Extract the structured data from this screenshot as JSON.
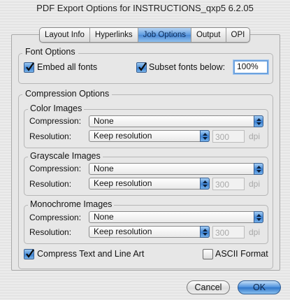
{
  "window": {
    "title": "PDF Export Options for INSTRUCTIONS_qxp5 6.2.05"
  },
  "tabs": [
    {
      "label": "Layout Info"
    },
    {
      "label": "Hyperlinks"
    },
    {
      "label": "Job Options",
      "active": true
    },
    {
      "label": "Output"
    },
    {
      "label": "OPI"
    }
  ],
  "font_options": {
    "title": "Font Options",
    "embed_all_fonts": {
      "label": "Embed all fonts",
      "checked": true
    },
    "subset_fonts": {
      "label": "Subset fonts below:",
      "checked": true,
      "value": "100%"
    }
  },
  "compression": {
    "title": "Compression Options",
    "groups": [
      {
        "title": "Color Images",
        "compression_label": "Compression:",
        "compression_value": "None",
        "resolution_label": "Resolution:",
        "resolution_value": "Keep resolution",
        "dpi_value": "300",
        "dpi_unit": "dpi"
      },
      {
        "title": "Grayscale Images",
        "compression_label": "Compression:",
        "compression_value": "None",
        "resolution_label": "Resolution:",
        "resolution_value": "Keep resolution",
        "dpi_value": "300",
        "dpi_unit": "dpi"
      },
      {
        "title": "Monochrome Images",
        "compression_label": "Compression:",
        "compression_value": "None",
        "resolution_label": "Resolution:",
        "resolution_value": "Keep resolution",
        "dpi_value": "300",
        "dpi_unit": "dpi"
      }
    ],
    "compress_text": {
      "label": "Compress Text and Line Art",
      "checked": true
    },
    "ascii_format": {
      "label": "ASCII Format",
      "checked": false
    }
  },
  "buttons": {
    "cancel": "Cancel",
    "ok": "OK"
  },
  "colors": {
    "accent": "#4a8fdc",
    "tab_active": "#5e9be0"
  }
}
